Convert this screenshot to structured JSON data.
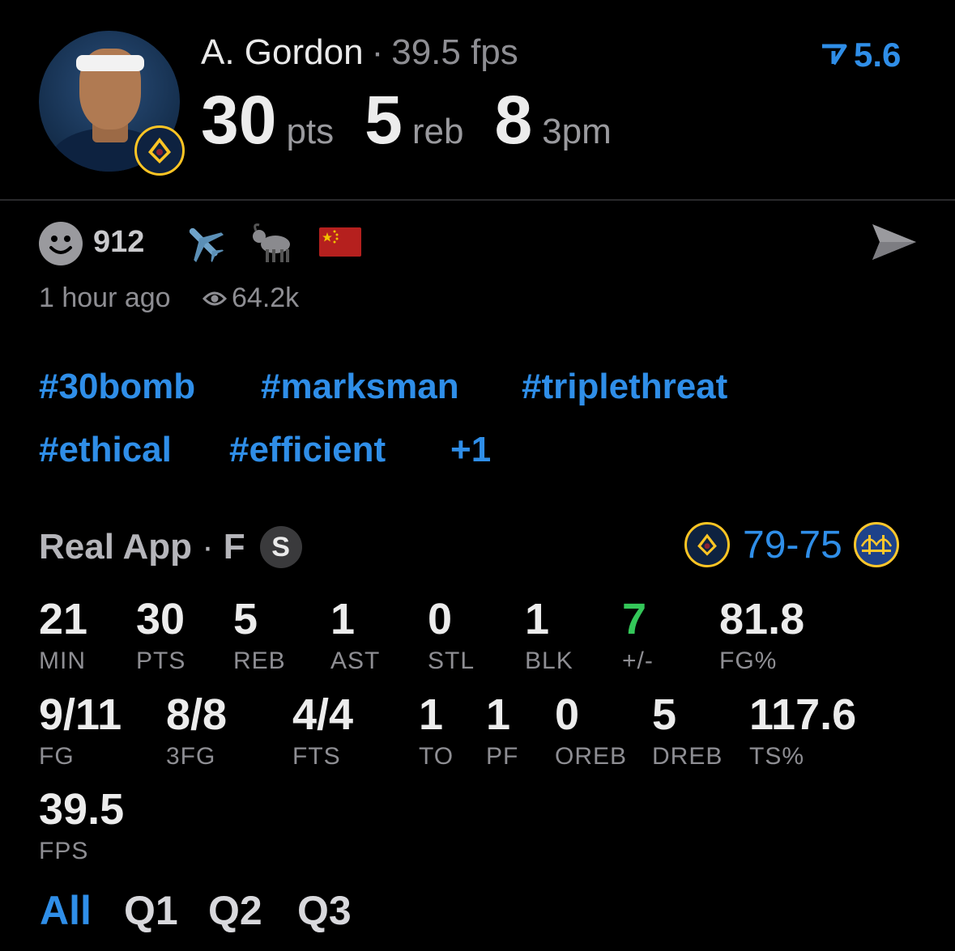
{
  "player": {
    "name": "A. Gordon",
    "fps_text": "39.5 fps",
    "rating": "5.6",
    "big_stats": [
      {
        "value": "30",
        "unit": "pts"
      },
      {
        "value": "5",
        "unit": "reb"
      },
      {
        "value": "8",
        "unit": "3pm"
      }
    ]
  },
  "reactions": {
    "count": "912",
    "time": "1 hour ago",
    "views": "64.2k",
    "emojis": [
      "airplane",
      "goat",
      "china-flag"
    ]
  },
  "tags": [
    "#30bomb",
    "#marksman",
    "#triplethreat",
    "#ethical",
    "#efficient",
    "+1"
  ],
  "game": {
    "source": "Real App",
    "position": "F",
    "badge": "S",
    "home_score": "79",
    "sep": "-",
    "away_score": "75"
  },
  "stats_row1": [
    {
      "value": "21",
      "label": "MIN"
    },
    {
      "value": "30",
      "label": "PTS"
    },
    {
      "value": "5",
      "label": "REB"
    },
    {
      "value": "1",
      "label": "AST"
    },
    {
      "value": "0",
      "label": "STL"
    },
    {
      "value": "1",
      "label": "BLK"
    },
    {
      "value": "7",
      "label": "+/-"
    },
    {
      "value": "81.8",
      "label": "FG%"
    }
  ],
  "stats_row2": [
    {
      "value": "9/11",
      "label": "FG"
    },
    {
      "value": "8/8",
      "label": "3FG"
    },
    {
      "value": "4/4",
      "label": "FTS"
    },
    {
      "value": "1",
      "label": "TO"
    },
    {
      "value": "1",
      "label": "PF"
    },
    {
      "value": "0",
      "label": "OREB"
    },
    {
      "value": "5",
      "label": "DREB"
    },
    {
      "value": "117.6",
      "label": "TS%"
    }
  ],
  "stats_row3": [
    {
      "value": "39.5",
      "label": "FPS"
    }
  ],
  "tabs": [
    "All",
    "Q1",
    "Q2",
    "Q3"
  ],
  "colors": {
    "accent": "#2f8ee8",
    "positive": "#34c759",
    "nuggets_gold": "#fec524",
    "nuggets_navy": "#0e2240",
    "warriors_blue": "#1d428a"
  }
}
